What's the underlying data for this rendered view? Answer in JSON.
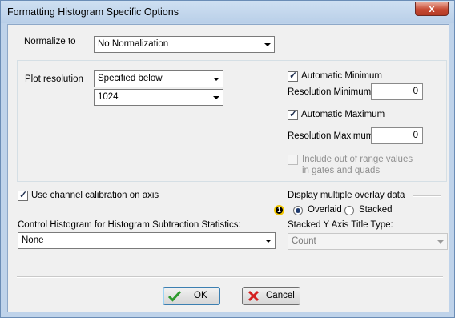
{
  "window": {
    "title": "Formatting Histogram Specific Options",
    "close_glyph": "x"
  },
  "normalize": {
    "label": "Normalize to",
    "value": "No Normalization"
  },
  "plot_resolution": {
    "label": "Plot resolution",
    "mode_value": "Specified below",
    "size_value": "1024"
  },
  "auto_min": {
    "label": "Automatic Minimum",
    "checked": true
  },
  "res_min": {
    "label": "Resolution Minimum",
    "value": "0"
  },
  "auto_max": {
    "label": "Automatic Maximum",
    "checked": true
  },
  "res_max": {
    "label": "Resolution Maximum",
    "value": "0"
  },
  "out_of_range": {
    "line1": "Include out of range values",
    "line2": "in gates and quads",
    "checked": false,
    "enabled": false
  },
  "channel_calibration": {
    "label": "Use channel calibration on axis",
    "checked": true
  },
  "overlay": {
    "heading": "Display multiple overlay data",
    "badge": "1",
    "options": [
      {
        "label": "Overlaid",
        "selected": true
      },
      {
        "label": "Stacked",
        "selected": false
      }
    ]
  },
  "control_histogram": {
    "label": "Control Histogram for Histogram Subtraction Statistics:",
    "value": "None"
  },
  "stacked_title": {
    "label": "Stacked Y Axis Title Type:",
    "value": "Count",
    "enabled": false
  },
  "buttons": {
    "ok": "OK",
    "cancel": "Cancel"
  },
  "colors": {
    "titlebar": "#bfd3ea",
    "dialog": "#f0f0f0",
    "close": "#c74a33",
    "ok_check": "#2e9b2e",
    "cancel_x": "#d42020",
    "badge_ring": "#f2c700"
  }
}
